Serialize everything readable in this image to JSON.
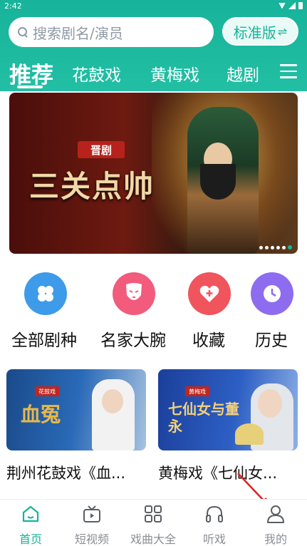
{
  "status": {
    "time": "2:42"
  },
  "search": {
    "placeholder": "搜索剧名/演员"
  },
  "edition_button": {
    "label": "标准版",
    "icon": "swap-icon"
  },
  "tabs": [
    {
      "label": "推荐",
      "active": true
    },
    {
      "label": "花鼓戏"
    },
    {
      "label": "黄梅戏"
    },
    {
      "label": "越剧"
    }
  ],
  "banner": {
    "tag": "晋剧",
    "title": "三关点帅",
    "slide_count": 6,
    "active_slide": 6
  },
  "quick_actions": [
    {
      "label": "全部剧种",
      "icon": "grid-flower-icon",
      "color": "#3d9be9"
    },
    {
      "label": "名家大腕",
      "icon": "mask-icon",
      "color": "#f25b7c"
    },
    {
      "label": "收藏",
      "icon": "heart-icon",
      "color": "#f0545d"
    },
    {
      "label": "历史",
      "icon": "clock-icon",
      "color": "#8e6cf0"
    }
  ],
  "cards": [
    {
      "caption": "荆州花鼓戏《血...",
      "tag": "花鼓戏",
      "poster_title": "血冤"
    },
    {
      "caption": "黄梅戏《七仙女...",
      "tag": "黄梅戏",
      "poster_title": "七仙女与董永"
    }
  ],
  "bottom_nav": [
    {
      "label": "首页",
      "icon": "home-icon",
      "active": true
    },
    {
      "label": "短视频",
      "icon": "tv-icon"
    },
    {
      "label": "戏曲大全",
      "icon": "grid-icon"
    },
    {
      "label": "听戏",
      "icon": "headphones-icon"
    },
    {
      "label": "我的",
      "icon": "user-icon"
    }
  ],
  "colors": {
    "accent": "#17b39a"
  }
}
